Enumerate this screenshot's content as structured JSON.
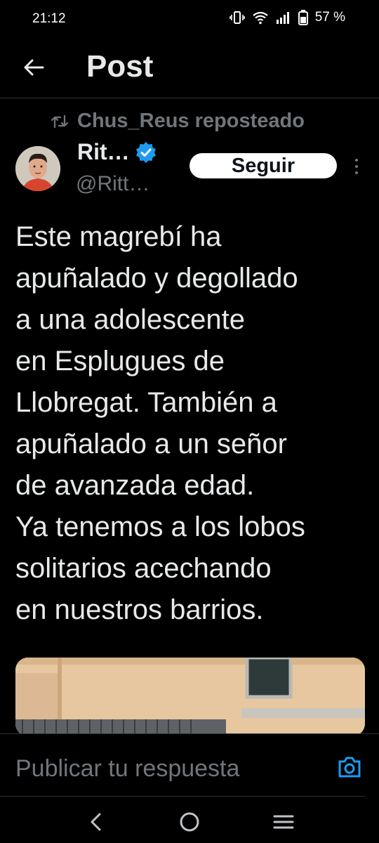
{
  "status_bar": {
    "time": "21:12",
    "battery": "57 %",
    "icons": [
      "vibrate-icon",
      "wifi-icon",
      "signal-icon",
      "battery-icon"
    ]
  },
  "header": {
    "title": "Post",
    "back_icon": "back-arrow-icon"
  },
  "repost": {
    "text": "Chus_Reus reposteado",
    "icon": "repost-icon"
  },
  "author": {
    "name": "Rit…",
    "handle": "@Ritt…",
    "verified": true,
    "follow_label": "Seguir"
  },
  "post": {
    "text": "Este magrebí ha\napuñalado y degollado\na una adolescente\nen Esplugues de\nLlobregat. También a\napuñalado a un señor\nde avanzada edad.\nYa tenemos a los lobos\nsolitarios acechando\nen nuestros barrios."
  },
  "reply": {
    "placeholder": "Publicar tu respuesta",
    "camera_icon": "camera-icon"
  },
  "nav_bar": {
    "icons": [
      "nav-back-icon",
      "nav-home-icon",
      "nav-menu-icon"
    ]
  },
  "colors": {
    "background": "#000000",
    "text_primary": "#e7e9ea",
    "text_secondary": "#71767b",
    "accent": "#1d9bf0",
    "follow_button_bg": "#ffffff"
  }
}
